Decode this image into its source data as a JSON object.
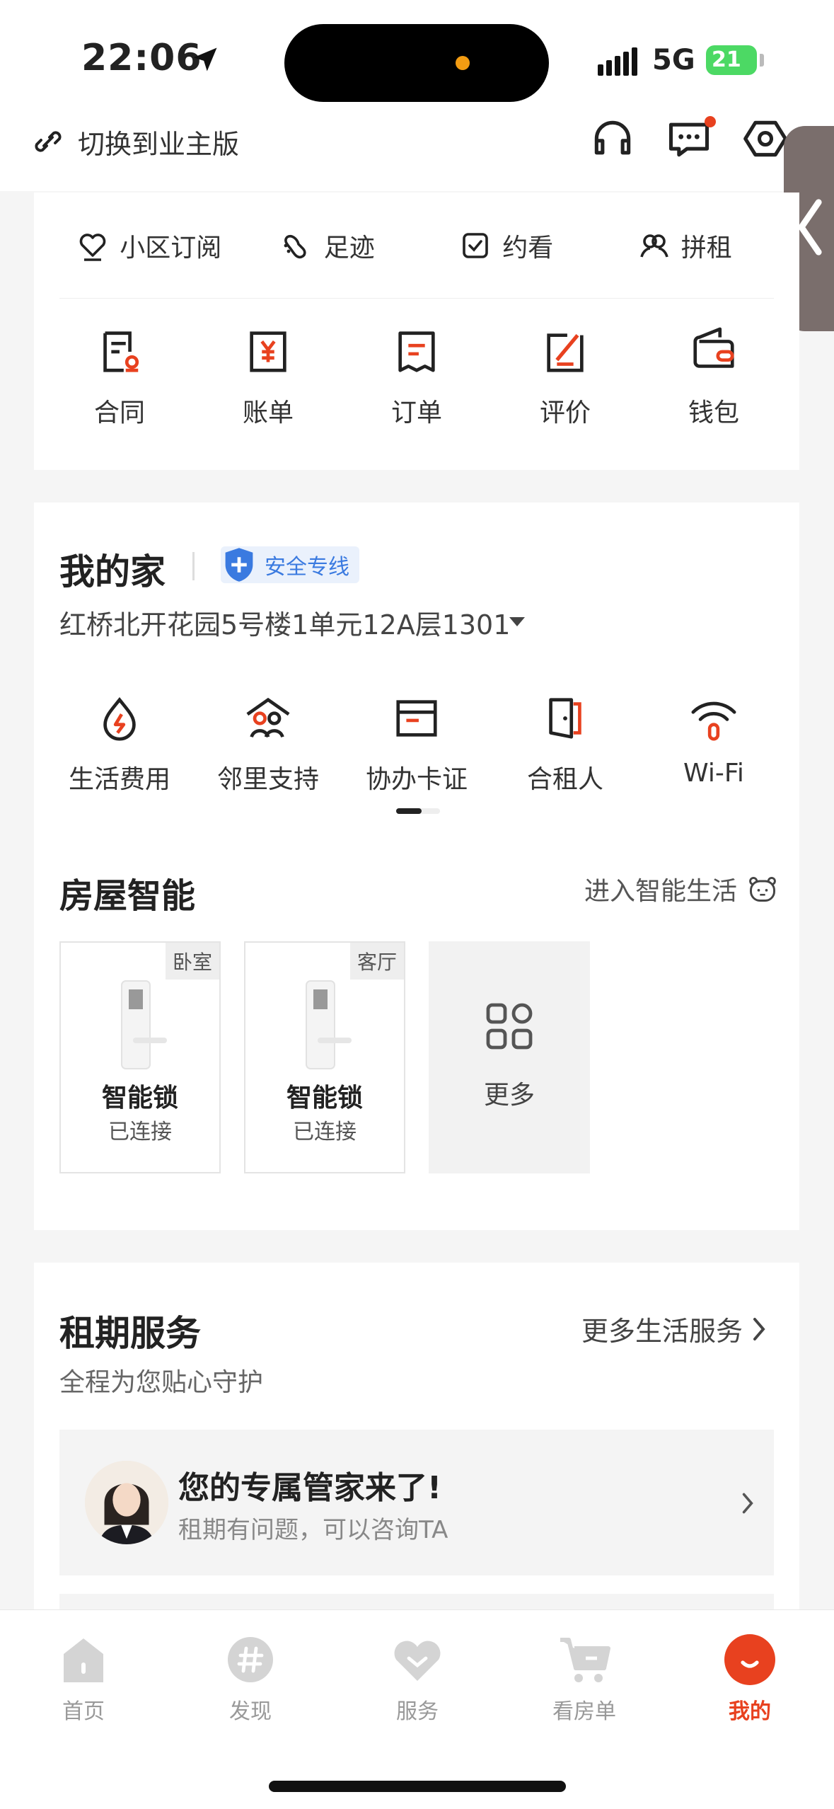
{
  "status": {
    "time": "22:06",
    "network": "5G",
    "battery": "21"
  },
  "topnav": {
    "switch_label": "切换到业主版"
  },
  "shortcuts": [
    {
      "label": "小区订阅",
      "icon": "heart-icon"
    },
    {
      "label": "足迹",
      "icon": "footprint-icon"
    },
    {
      "label": "约看",
      "icon": "checkbox-icon"
    },
    {
      "label": "拼租",
      "icon": "people-icon"
    }
  ],
  "quick_grid": [
    {
      "label": "合同",
      "icon": "contract-icon"
    },
    {
      "label": "账单",
      "icon": "bill-icon"
    },
    {
      "label": "订单",
      "icon": "order-icon"
    },
    {
      "label": "评价",
      "icon": "review-icon"
    },
    {
      "label": "钱包",
      "icon": "wallet-icon"
    }
  ],
  "home": {
    "title": "我的家",
    "badge": "安全专线",
    "address": "红桥北开花园5号楼1单元12A层1301",
    "services": [
      {
        "label": "生活费用",
        "icon": "utility-icon"
      },
      {
        "label": "邻里支持",
        "icon": "neighbor-icon"
      },
      {
        "label": "协办卡证",
        "icon": "card-icon"
      },
      {
        "label": "合租人",
        "icon": "door-icon"
      },
      {
        "label": "Wi-Fi",
        "icon": "wifi-icon"
      }
    ],
    "smart": {
      "title": "房屋智能",
      "link": "进入智能生活",
      "devices": [
        {
          "room": "卧室",
          "name": "智能锁",
          "status": "已连接"
        },
        {
          "room": "客厅",
          "name": "智能锁",
          "status": "已连接"
        }
      ],
      "more": "更多"
    }
  },
  "lease": {
    "title": "租期服务",
    "more": "更多生活服务",
    "subtitle": "全程为您贴心守护",
    "steward_title": "您的专属管家来了!",
    "steward_sub": "租期有问题，可以咨询TA"
  },
  "tabbar": [
    {
      "label": "首页",
      "icon": "home-icon"
    },
    {
      "label": "发现",
      "icon": "discover-icon"
    },
    {
      "label": "服务",
      "icon": "service-heart-icon"
    },
    {
      "label": "看房单",
      "icon": "cart-icon"
    },
    {
      "label": "我的",
      "icon": "me-icon",
      "active": true
    }
  ],
  "colors": {
    "accent": "#e8411f",
    "safe_blue": "#3a7ae0"
  }
}
